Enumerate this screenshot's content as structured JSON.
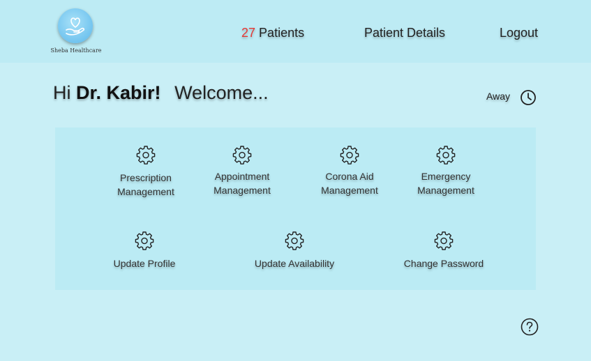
{
  "brand": {
    "name": "Sheba Healthcare",
    "logo_icon": "heart-hand-icon",
    "logo_color": "#72c4ef"
  },
  "nav": {
    "patient_count": "27",
    "patients_label": "Patients",
    "patient_details_label": "Patient Details",
    "logout_label": "Logout"
  },
  "greeting": {
    "hi": "Hi",
    "doctor_name": "Dr. Kabir!",
    "welcome": "Welcome..."
  },
  "status": {
    "label": "Away",
    "icon": "clock-icon"
  },
  "menu": {
    "row1": [
      {
        "line1": "Prescription",
        "line2": "Management",
        "icon": "gear-icon"
      },
      {
        "line1": "Appointment",
        "line2": "Management",
        "icon": "gear-icon"
      },
      {
        "line1": "Corona Aid",
        "line2": "Management",
        "icon": "gear-icon"
      },
      {
        "line1": "Emergency",
        "line2": "Management",
        "icon": "gear-icon"
      }
    ],
    "row2": [
      {
        "label": "Update Profile",
        "icon": "gear-icon"
      },
      {
        "label": "Update Availability",
        "icon": "gear-icon"
      },
      {
        "label": "Change Password",
        "icon": "gear-icon"
      }
    ]
  },
  "help": {
    "icon": "help-icon"
  },
  "colors": {
    "background": "#c9eff6",
    "header": "#bdebf4",
    "panel": "#bbebf4",
    "accent_count": "#e53935"
  }
}
